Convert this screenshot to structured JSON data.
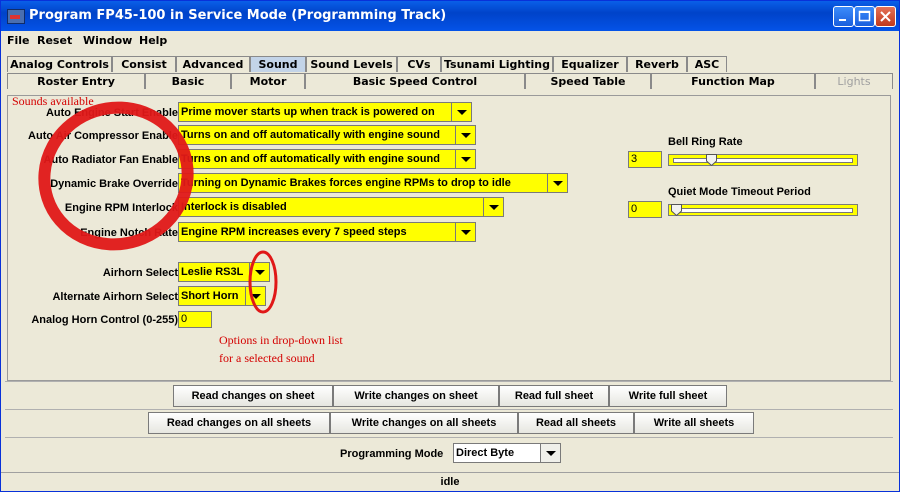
{
  "window": {
    "title": "Program FP45-100 in Service Mode (Programming Track)"
  },
  "menu": [
    "File",
    "Reset",
    "Window",
    "Help"
  ],
  "tabs_row1": [
    {
      "label": "Analog Controls",
      "selected": false
    },
    {
      "label": "Consist",
      "selected": false
    },
    {
      "label": "Advanced",
      "selected": false
    },
    {
      "label": "Sound",
      "selected": true
    },
    {
      "label": "Sound Levels",
      "selected": false
    },
    {
      "label": "CVs",
      "selected": false
    },
    {
      "label": "Tsunami Lighting",
      "selected": false
    },
    {
      "label": "Equalizer",
      "selected": false
    },
    {
      "label": "Reverb",
      "selected": false
    },
    {
      "label": "ASC",
      "selected": false
    }
  ],
  "tabs_row2": [
    {
      "label": "Roster Entry",
      "disabled": false
    },
    {
      "label": "Basic",
      "disabled": false
    },
    {
      "label": "Motor",
      "disabled": false
    },
    {
      "label": "Basic Speed Control",
      "disabled": false
    },
    {
      "label": "Speed Table",
      "disabled": false
    },
    {
      "label": "Function Map",
      "disabled": false
    },
    {
      "label": "Lights",
      "disabled": true
    }
  ],
  "annotations": {
    "sounds_available": "Sounds available",
    "dropdown_note_line1": "Options in drop-down list",
    "dropdown_note_line2": "for a selected sound"
  },
  "settings": [
    {
      "label": "Auto Engine Start Enable",
      "value": "Prime mover starts up when track is powered on"
    },
    {
      "label": "Auto Air Compressor Enable",
      "value": "Turns on and off automatically with engine sound"
    },
    {
      "label": "Auto Radiator Fan Enable",
      "value": "Turns on and off automatically with engine sound"
    },
    {
      "label": "Dynamic Brake Override",
      "value": "Turning on Dynamic Brakes forces engine RPMs to drop to idle"
    },
    {
      "label": "Engine RPM Interlock",
      "value": "Interlock is disabled"
    },
    {
      "label": "Engine Notch Rate",
      "value": "Engine RPM increases every 7 speed steps"
    }
  ],
  "horns": [
    {
      "label": "Airhorn Select",
      "value": "Leslie RS3L"
    },
    {
      "label": "Alternate Airhorn Select",
      "value": "Short Horn"
    }
  ],
  "analog_horn": {
    "label": "Analog Horn Control (0-255)",
    "value": "0"
  },
  "bell": {
    "label": "Bell Ring Rate",
    "value": "3",
    "slider_fraction": 0.2
  },
  "quiet": {
    "label": "Quiet Mode Timeout Period",
    "value": "0",
    "slider_fraction": 0.0
  },
  "buttons_row1": [
    "Read changes on sheet",
    "Write changes on sheet",
    "Read full sheet",
    "Write full sheet"
  ],
  "buttons_row2": [
    "Read changes on all sheets",
    "Write changes on all sheets",
    "Read all sheets",
    "Write all sheets"
  ],
  "programming_mode": {
    "label": "Programming Mode",
    "value": "Direct Byte"
  },
  "status": "idle",
  "colors": {
    "field_bg": "#ffff00",
    "annotation_red": "#d40000",
    "titlebar": "#0453e8"
  }
}
